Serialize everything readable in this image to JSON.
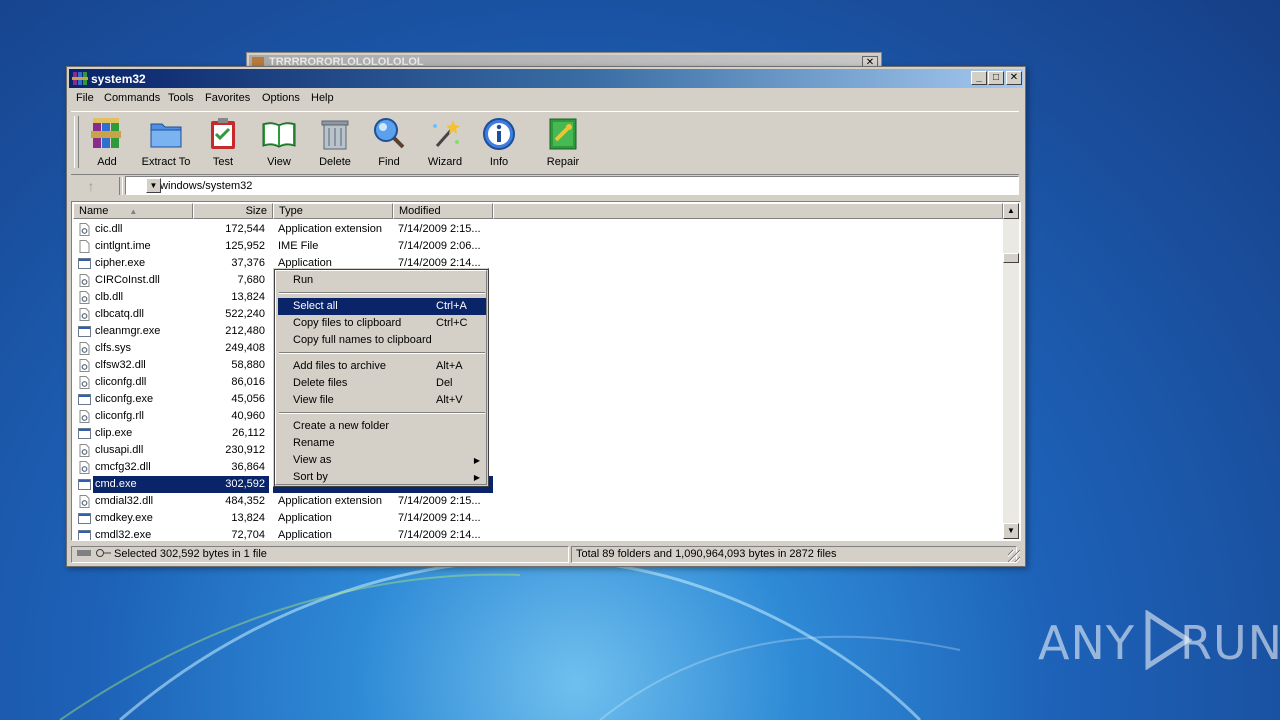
{
  "background_window": {
    "title": "TRRRRORORLOLOLOLOLOL"
  },
  "window": {
    "title": "system32",
    "menu": [
      "File",
      "Commands",
      "Tools",
      "Favorites",
      "Options",
      "Help"
    ],
    "toolbar": [
      {
        "label": "Add",
        "icon": "add-archive-icon"
      },
      {
        "label": "Extract To",
        "icon": "extract-folder-icon"
      },
      {
        "label": "Test",
        "icon": "test-clipboard-icon"
      },
      {
        "label": "View",
        "icon": "view-book-icon"
      },
      {
        "label": "Delete",
        "icon": "trash-icon"
      },
      {
        "label": "Find",
        "icon": "magnifier-icon"
      },
      {
        "label": "Wizard",
        "icon": "magic-wand-icon"
      },
      {
        "label": "Info",
        "icon": "info-icon"
      },
      {
        "label": "Repair",
        "icon": "repair-kit-icon"
      }
    ],
    "address": "C:/windows/system32",
    "columns": {
      "name": "Name",
      "size": "Size",
      "type": "Type",
      "modified": "Modified"
    },
    "files": [
      {
        "name": "cic.dll",
        "size": "172,544",
        "type": "Application extension",
        "modified": "7/14/2009 2:15..."
      },
      {
        "name": "cintlgnt.ime",
        "size": "125,952",
        "type": "IME File",
        "modified": "7/14/2009 2:06..."
      },
      {
        "name": "cipher.exe",
        "size": "37,376",
        "type": "Application",
        "modified": "7/14/2009 2:14..."
      },
      {
        "name": "CIRCoInst.dll",
        "size": "7,680",
        "type": "",
        "modified": ""
      },
      {
        "name": "clb.dll",
        "size": "13,824",
        "type": "",
        "modified": ""
      },
      {
        "name": "clbcatq.dll",
        "size": "522,240",
        "type": "",
        "modified": ""
      },
      {
        "name": "cleanmgr.exe",
        "size": "212,480",
        "type": "",
        "modified": ""
      },
      {
        "name": "clfs.sys",
        "size": "249,408",
        "type": "",
        "modified": ""
      },
      {
        "name": "clfsw32.dll",
        "size": "58,880",
        "type": "",
        "modified": ""
      },
      {
        "name": "cliconfg.dll",
        "size": "86,016",
        "type": "",
        "modified": ""
      },
      {
        "name": "cliconfg.exe",
        "size": "45,056",
        "type": "",
        "modified": ""
      },
      {
        "name": "cliconfg.rll",
        "size": "40,960",
        "type": "",
        "modified": ""
      },
      {
        "name": "clip.exe",
        "size": "26,112",
        "type": "",
        "modified": ""
      },
      {
        "name": "clusapi.dll",
        "size": "230,912",
        "type": "",
        "modified": ""
      },
      {
        "name": "cmcfg32.dll",
        "size": "36,864",
        "type": "",
        "modified": ""
      },
      {
        "name": "cmd.exe",
        "size": "302,592",
        "type": "",
        "modified": "",
        "selected": true
      },
      {
        "name": "cmdial32.dll",
        "size": "484,352",
        "type": "Application extension",
        "modified": "7/14/2009 2:15..."
      },
      {
        "name": "cmdkey.exe",
        "size": "13,824",
        "type": "Application",
        "modified": "7/14/2009 2:14..."
      },
      {
        "name": "cmdl32.exe",
        "size": "72,704",
        "type": "Application",
        "modified": "7/14/2009 2:14..."
      }
    ],
    "status": {
      "left": "Selected 302,592 bytes in 1 file",
      "right": "Total 89 folders and 1,090,964,093 bytes in 2872 files"
    }
  },
  "context_menu": {
    "items": [
      {
        "label": "Run",
        "shortcut": ""
      },
      {
        "sep": true
      },
      {
        "label": "Select all",
        "shortcut": "Ctrl+A",
        "highlighted": true
      },
      {
        "label": "Copy files to clipboard",
        "shortcut": "Ctrl+C"
      },
      {
        "label": "Copy full names to clipboard",
        "shortcut": ""
      },
      {
        "sep": true
      },
      {
        "label": "Add files to archive",
        "shortcut": "Alt+A"
      },
      {
        "label": "Delete files",
        "shortcut": "Del"
      },
      {
        "label": "View file",
        "shortcut": "Alt+V"
      },
      {
        "sep": true
      },
      {
        "label": "Create a new folder",
        "shortcut": ""
      },
      {
        "label": "Rename",
        "shortcut": ""
      },
      {
        "label": "View as",
        "shortcut": "",
        "submenu": true
      },
      {
        "label": "Sort by",
        "shortcut": "",
        "submenu": true
      }
    ]
  },
  "watermark": {
    "left": "ANY",
    "right": "RUN"
  },
  "colors": {
    "selection": "#0a246a",
    "face": "#d4d0c8",
    "desktop": "#1d62b8"
  }
}
